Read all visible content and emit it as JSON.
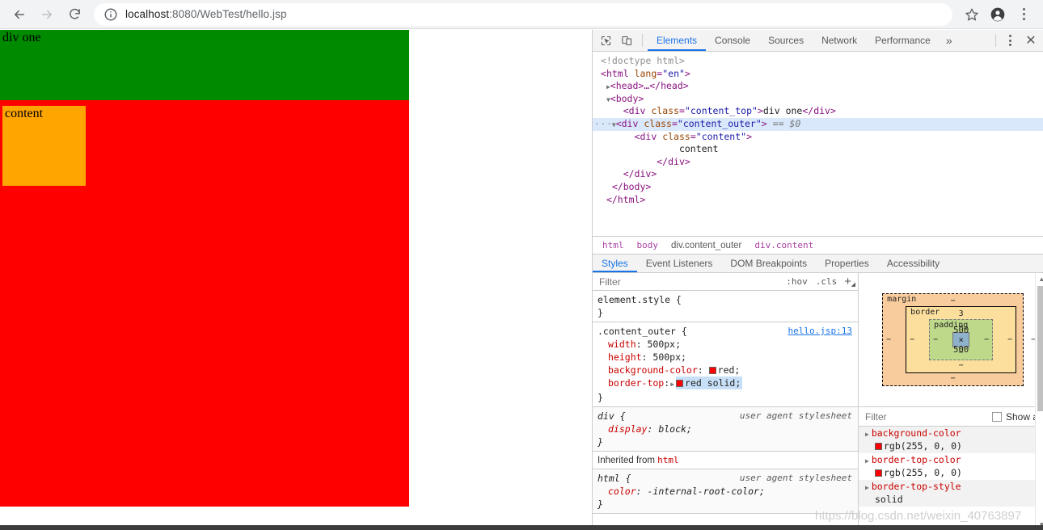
{
  "browser": {
    "back_label": "Back",
    "forward_label": "Forward",
    "reload_label": "Reload",
    "info_icon": "info-circle-icon",
    "url_host": "localhost",
    "url_path": ":8080/WebTest/hello.jsp",
    "url_full": "localhost:8080/WebTest/hello.jsp",
    "bookmark_label": "Bookmark this page",
    "profile_label": "Profile",
    "menu_label": "Customize and control Google Chrome"
  },
  "page": {
    "div_one_text": "div one",
    "content_text": "content",
    "colors": {
      "content_top": "#008a00",
      "content_outer": "#ff0000",
      "content": "#ffa500"
    }
  },
  "devtools": {
    "tools": {
      "inspect": "inspect-element-icon",
      "device": "device-toolbar-icon",
      "more_tabs": "»",
      "kebab": "more-options-icon",
      "close": "✕"
    },
    "tabs": [
      {
        "label": "Elements",
        "active": true
      },
      {
        "label": "Console",
        "active": false
      },
      {
        "label": "Sources",
        "active": false
      },
      {
        "label": "Network",
        "active": false
      },
      {
        "label": "Performance",
        "active": false
      }
    ],
    "dom": {
      "l0": "<!doctype html>",
      "l1_tag": "html",
      "l1_attr": "lang",
      "l1_val": "\"en\"",
      "l2": "<head>…</head>",
      "l3": "<body>",
      "l4_attr": "class",
      "l4_val": "\"content_top\"",
      "l4_text": "div one",
      "l5_attr": "class",
      "l5_val": "\"content_outer\"",
      "l5_marker": "== $0",
      "l6_attr": "class",
      "l6_val": "\"content\"",
      "l7_text": "content",
      "l8": "</div>",
      "l9": "</div>",
      "l10": "</body>",
      "l11": "</html>",
      "ellipsis": "···"
    },
    "breadcrumb": [
      "html",
      "body",
      "div.content_outer",
      "div.content"
    ],
    "styles_tabs": [
      {
        "label": "Styles",
        "active": true
      },
      {
        "label": "Event Listeners",
        "active": false
      },
      {
        "label": "DOM Breakpoints",
        "active": false
      },
      {
        "label": "Properties",
        "active": false
      },
      {
        "label": "Accessibility",
        "active": false
      }
    ],
    "styles_toolbar": {
      "filter_placeholder": "Filter",
      "hov": ":hov",
      "cls": ".cls",
      "plus": "+"
    },
    "rules": {
      "element_style": {
        "selector": "element.style {",
        "close": "}"
      },
      "content_outer": {
        "selector": ".content_outer {",
        "origin": "hello.jsp:13",
        "close": "}",
        "declarations": [
          {
            "name": "width",
            "value": "500px",
            "swatch": null
          },
          {
            "name": "height",
            "value": "500px",
            "swatch": null
          },
          {
            "name": "background-color",
            "value": "red",
            "swatch": "#ff0000"
          },
          {
            "name": "border-top",
            "value": "red solid",
            "swatch": "#ff0000",
            "shorthand": true,
            "highlight": true
          }
        ]
      },
      "div_ua": {
        "selector": "div {",
        "origin": "user agent stylesheet",
        "close": "}",
        "declarations": [
          {
            "name": "display",
            "value": "block",
            "swatch": null
          }
        ]
      },
      "inherited_header": "Inherited from",
      "inherited_from": "html",
      "html_ua": {
        "selector": "html {",
        "origin": "user agent stylesheet",
        "close": "}",
        "declarations": [
          {
            "name": "color",
            "value": "-internal-root-color",
            "swatch": null
          }
        ]
      }
    },
    "box_model": {
      "margin_label": "margin",
      "margin_top": "−",
      "margin_right": "−",
      "margin_bottom": "−",
      "margin_left": "−",
      "border_label": "border",
      "border_top": "3",
      "border_right": "−",
      "border_bottom": "−",
      "border_left": "−",
      "padding_label": "padding",
      "padding_top": "−",
      "padding_right": "−",
      "padding_bottom": "−",
      "padding_left": "−",
      "content_size": "500 × 500"
    },
    "computed": {
      "filter_placeholder": "Filter",
      "show_all_label": "Show all",
      "properties": [
        {
          "name": "background-color",
          "value": "rgb(255, 0, 0)",
          "swatch": "#ff0000"
        },
        {
          "name": "border-top-color",
          "value": "rgb(255, 0, 0)",
          "swatch": "#ff0000"
        },
        {
          "name": "border-top-style",
          "value": "solid",
          "swatch": null
        }
      ]
    }
  },
  "watermark": "https://blog.csdn.net/weixin_40763897"
}
